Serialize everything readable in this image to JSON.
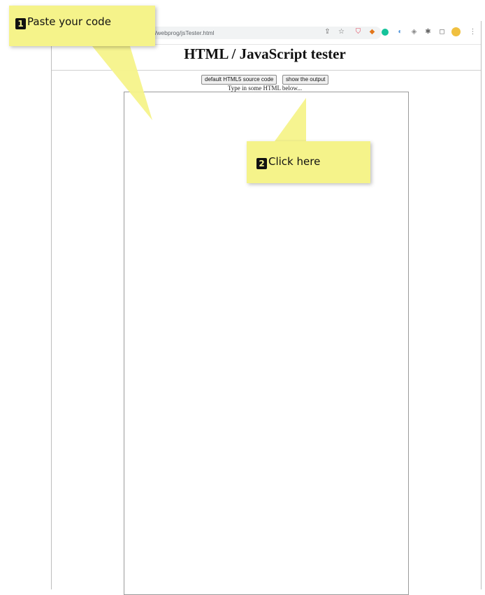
{
  "browser": {
    "url": "hr-web.edu/~ajharris/webprog/jsTester.html",
    "url_visible": "u/~ajharris/webprog/jsTester.html"
  },
  "page": {
    "title": "HTML / JavaScript tester",
    "default_button": "default HTML5 source code",
    "output_button": "show the output",
    "hint": "Type in some HTML below..."
  },
  "callouts": {
    "paste": {
      "num": "1",
      "text": "Paste your code"
    },
    "click": {
      "num": "2",
      "text": "Click here"
    }
  },
  "colors": {
    "callout_bg": "#f5f38a",
    "pocket": "#e0445a",
    "metamask": "#e2761b",
    "grammarly": "#15c39a"
  }
}
